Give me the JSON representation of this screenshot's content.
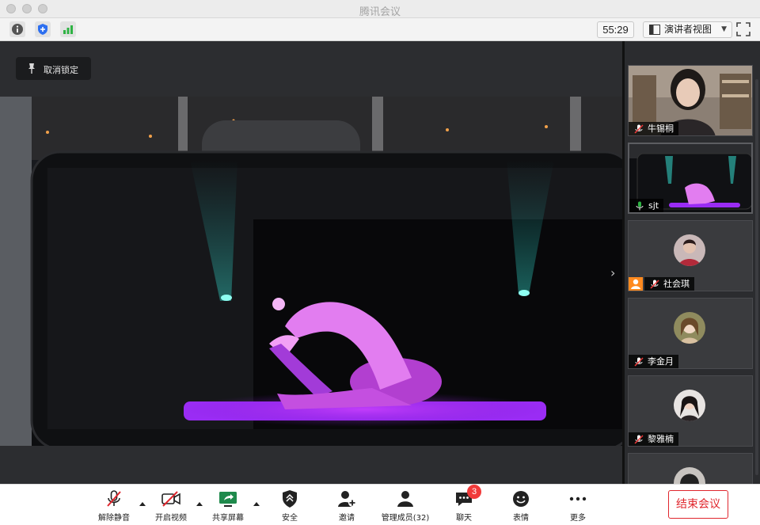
{
  "window": {
    "title": "腾讯会议"
  },
  "toolbar": {
    "timer": "55:29",
    "view_mode": "演讲者视图",
    "icons": [
      "info-icon",
      "shield-icon",
      "signal-bars-icon",
      "fullscreen-icon"
    ]
  },
  "main": {
    "unlock_label": "取消锁定",
    "shared_content": "dancer-video"
  },
  "participants": [
    {
      "name": "牛锡桐",
      "camera": true,
      "muted": true
    },
    {
      "name": "sjt",
      "camera": true,
      "muted": false,
      "active_speaker": true
    },
    {
      "name": "社会琪",
      "camera": false,
      "muted": true,
      "host": true
    },
    {
      "name": "李金月",
      "camera": false,
      "muted": true
    },
    {
      "name": "黎雅楠",
      "camera": false,
      "muted": true
    }
  ],
  "bottom": {
    "unmute": "解除静音",
    "start_video": "开启视频",
    "share_screen": "共享屏幕",
    "security": "安全",
    "invite": "邀请",
    "manage_members": "管理成员(32)",
    "chat": "聊天",
    "chat_badge": "3",
    "reactions": "表情",
    "more": "更多",
    "end_meeting": "结束会议"
  },
  "colors": {
    "end_button": "#e0262d",
    "badge": "#f13a3a",
    "host_badge": "#ff8a1f",
    "accent_green": "#2fb344"
  }
}
